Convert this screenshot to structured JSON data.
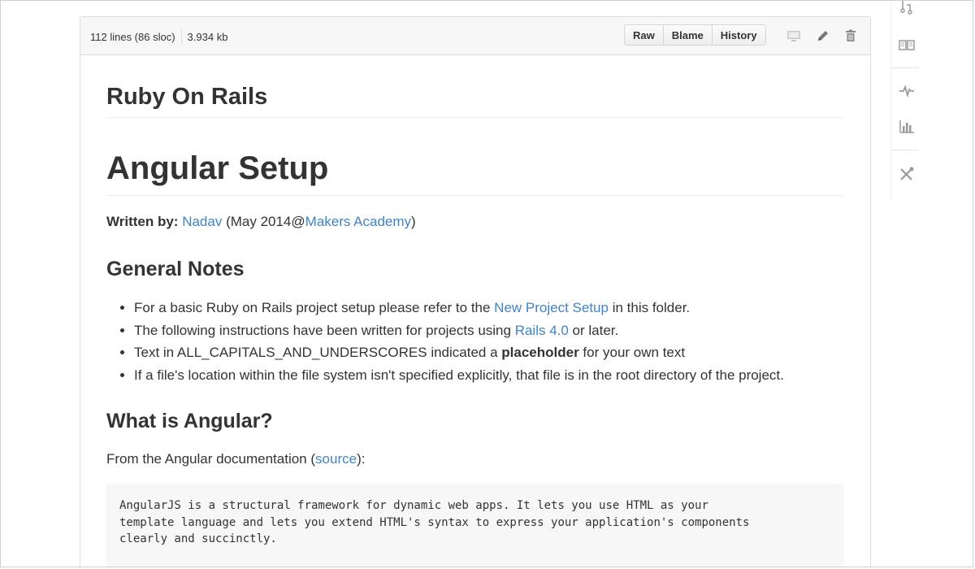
{
  "file_header": {
    "lines": "112 lines (86 sloc)",
    "size": "3.934 kb",
    "buttons": [
      "Raw",
      "Blame",
      "History"
    ],
    "tool_icons": [
      "desktop-icon",
      "pencil-icon",
      "trash-icon"
    ]
  },
  "readme": {
    "repo_title": "Ruby On Rails",
    "main_title": "Angular Setup",
    "written_by": {
      "label": "Written by:",
      "author_link": "Nadav",
      "date_prefix": " (May 2014@",
      "org_link": "Makers Academy",
      "suffix": ")"
    },
    "general_notes": {
      "heading": "General Notes",
      "items": [
        {
          "before": "For a basic Ruby on Rails project setup please refer to the ",
          "link": "New Project Setup",
          "after": " in this folder."
        },
        {
          "before": "The following instructions have been written for projects using ",
          "link": "Rails 4.0",
          "after": " or later."
        },
        {
          "before": "Text in ALL_CAPITALS_AND_UNDERSCORES indicated a ",
          "bold": "placeholder",
          "after": " for your own text"
        },
        {
          "before": "If a file's location within the file system isn't specified explicitly, that file is in the root directory of the project."
        }
      ]
    },
    "what_is_angular": {
      "heading": "What is Angular?",
      "intro_before": "From the Angular documentation (",
      "intro_link": "source",
      "intro_after": "):",
      "code": "AngularJS is a structural framework for dynamic web apps. It lets you use HTML as your\ntemplate language and lets you extend HTML's syntax to express your application's components\nclearly and succinctly.\n\nAngular is what HTML would have been had it been designed for"
    }
  },
  "sidebar": {
    "icons": [
      "pull-request-icon",
      "book-icon",
      "pulse-icon",
      "graph-icon",
      "tools-icon"
    ]
  },
  "colors": {
    "link": "#4183c4",
    "text": "#333333",
    "code_bg": "#f7f7f7",
    "header_bg": "#f7f7f7"
  }
}
